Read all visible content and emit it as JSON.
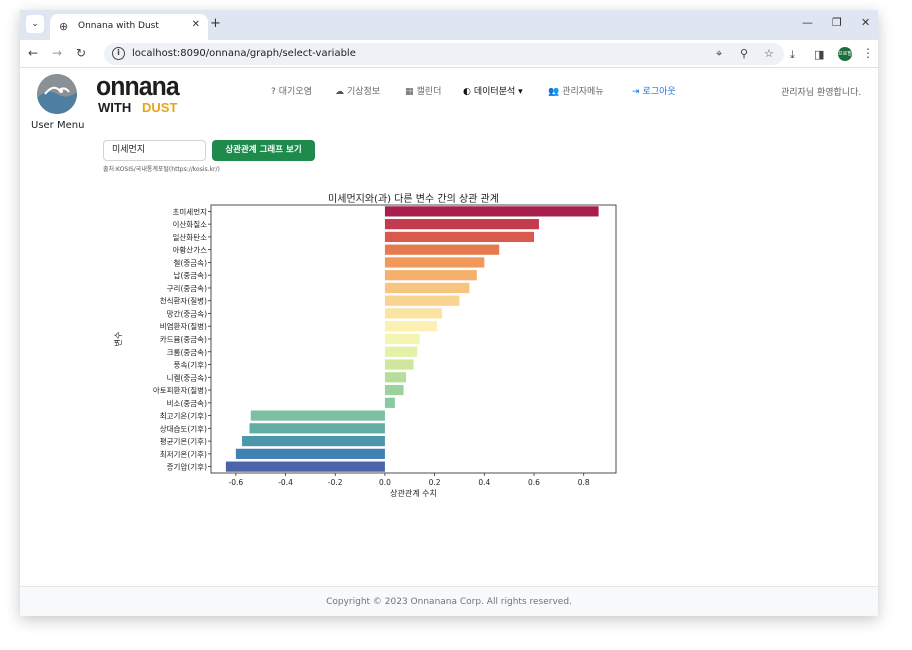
{
  "browser": {
    "tab_title": "Onnana with Dust",
    "url": "localhost:8090/onnana/graph/select-variable",
    "profile_label": "프로필"
  },
  "sidebar": {
    "user_menu_label": "User Menu"
  },
  "logo": {
    "line1": "onnana",
    "line2_a": "WITH",
    "line2_b": "DUST"
  },
  "navbar": {
    "items": [
      {
        "icon": "question-icon",
        "label": "대기오염"
      },
      {
        "icon": "cloud-icon",
        "label": "기상정보"
      },
      {
        "icon": "calendar-icon",
        "label": "캘린더"
      },
      {
        "icon": "globe-icon",
        "label": "데이터분석"
      },
      {
        "icon": "users-icon",
        "label": "관리자메뉴"
      },
      {
        "icon": "logout-icon",
        "label": "로그아웃"
      }
    ],
    "welcome": "관리자님 환영합니다."
  },
  "controls": {
    "input_value": "미세먼지",
    "graph_button": "상관관계 그래프 보기",
    "source": "출처:KOSIS/국내통계포털(https://kosis.kr/)"
  },
  "chart_data": {
    "type": "bar",
    "orientation": "horizontal",
    "title": "미세먼지와(과) 다른 변수 간의 상관 관계",
    "xlabel": "상관관계 수치",
    "ylabel": "변수",
    "xlim": [
      -0.7,
      0.93
    ],
    "xticks": [
      -0.6,
      -0.4,
      -0.2,
      0.0,
      0.2,
      0.4,
      0.6,
      0.8
    ],
    "xtick_labels": [
      "-0.6",
      "-0.4",
      "-0.2",
      "0.0",
      "0.2",
      "0.4",
      "0.6",
      "0.8"
    ],
    "categories": [
      "초미세먼지",
      "이산화질소",
      "일산화탄소",
      "아황산가스",
      "철(중금속)",
      "납(중금속)",
      "구리(중금속)",
      "천식환자(질병)",
      "망간(중금속)",
      "비염환자(질병)",
      "카드뮴(중금속)",
      "크롬(중금속)",
      "풍속(기후)",
      "니켈(중금속)",
      "아토피환자(질병)",
      "비소(중금속)",
      "최고기온(기후)",
      "상대습도(기후)",
      "평균기온(기후)",
      "최저기온(기후)",
      "증기압(기후)"
    ],
    "values": [
      0.86,
      0.62,
      0.6,
      0.46,
      0.4,
      0.37,
      0.34,
      0.3,
      0.23,
      0.21,
      0.14,
      0.13,
      0.115,
      0.085,
      0.075,
      0.04,
      -0.54,
      -0.545,
      -0.575,
      -0.6,
      -0.64
    ],
    "colors": [
      "#a6204b",
      "#c43b4e",
      "#d95a4c",
      "#e57a4f",
      "#f0995b",
      "#f5b16c",
      "#f8c57f",
      "#f9d390",
      "#fbe3a2",
      "#fcf0b2",
      "#f3f5b0",
      "#e3f2a6",
      "#cde89d",
      "#b6de99",
      "#9dd29d",
      "#88c9a2",
      "#7cbfa2",
      "#62aea5",
      "#4d97ac",
      "#4180b2",
      "#4c63aa"
    ],
    "grid": false
  },
  "footer": {
    "copyright": "Copyright © 2023 Onnanana Corp. All rights reserved."
  }
}
